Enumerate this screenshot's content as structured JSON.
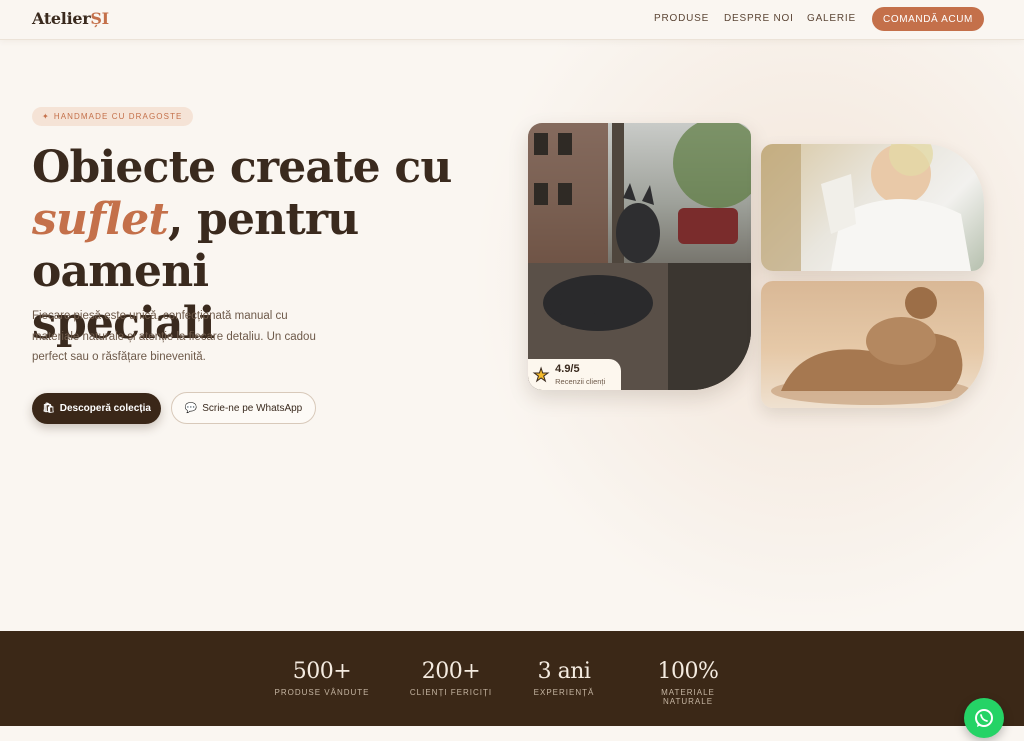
{
  "header": {
    "logo_main": "Atelier",
    "logo_accent": "ȘI",
    "nav": [
      "PRODUSE",
      "DESPRE NOI",
      "GALERIE"
    ],
    "cta": "COMANDĂ ACUM"
  },
  "hero": {
    "badge": "HANDMADE CU DRAGOSTE",
    "headline_1": "Obiecte create cu",
    "headline_em": "suflet",
    "headline_2": ", pentru oameni",
    "headline_3": "speciali",
    "subtitle": "Fiecare piesă este unică, confecționată manual cu materiale naturale și atenție la fiecare detaliu. Un cadou perfect sau o răsfățare binevenită.",
    "primary_button": "Descoperă colecția",
    "secondary_button": "Scrie-ne pe WhatsApp"
  },
  "rating": {
    "value": "4.9/5",
    "label": "Recenzii clienți"
  },
  "stats": [
    {
      "value": "500+",
      "label": "PRODUSE VÂNDUTE"
    },
    {
      "value": "200+",
      "label": "CLIENȚI FERICIȚI"
    },
    {
      "value": "3 ani",
      "label": "EXPERIENȚĂ"
    },
    {
      "value": "100%",
      "label": "MATERIALE NATURALE"
    }
  ],
  "colors": {
    "accent": "#c4704a",
    "dark": "#3b2817",
    "background": "#faf6f1",
    "whatsapp": "#25d366"
  },
  "icons": [
    "star-icon",
    "whatsapp-icon",
    "bag-icon",
    "chat-icon"
  ]
}
